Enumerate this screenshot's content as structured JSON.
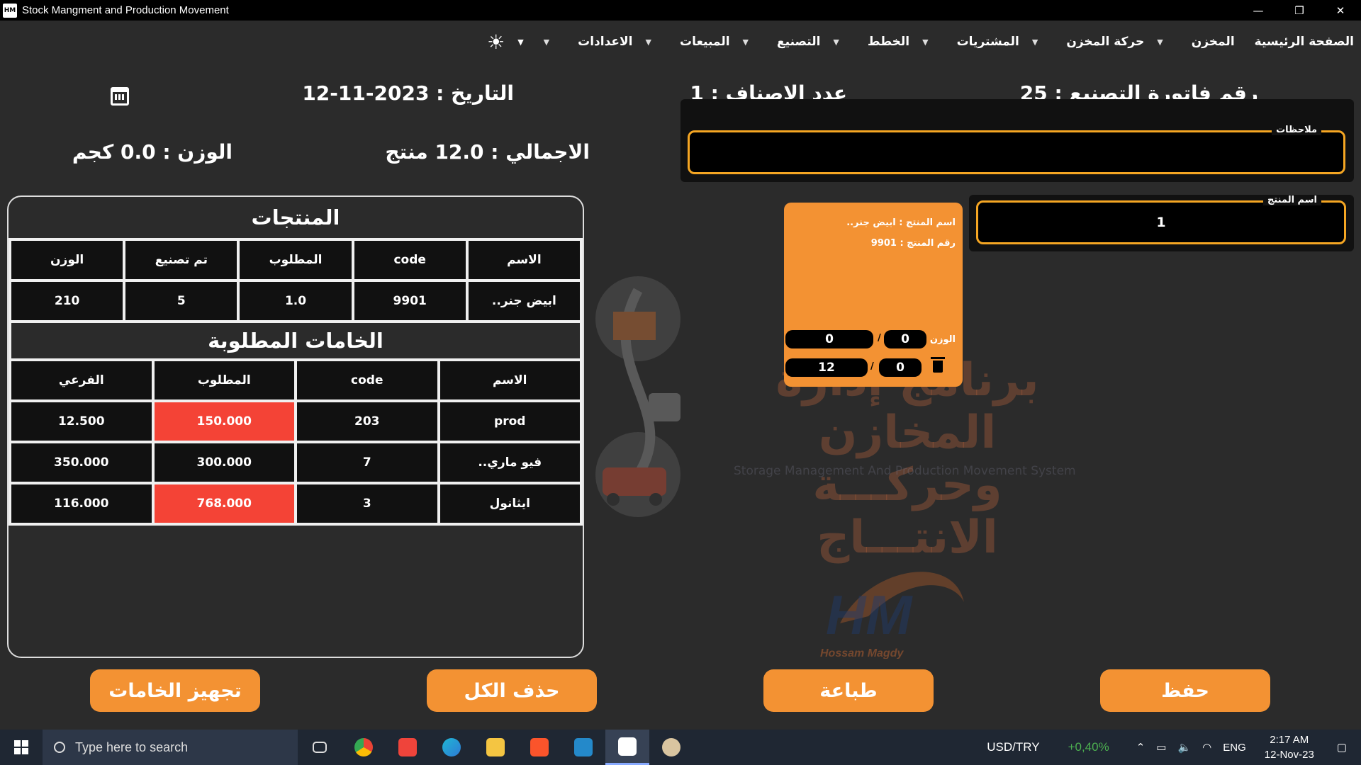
{
  "window": {
    "title": "Stock Mangment and Production Movement",
    "app_icon": "HM"
  },
  "menu": {
    "items": [
      {
        "label": "الصفحة الرئيسية",
        "has_caret": false
      },
      {
        "label": "المخزن",
        "has_caret": true
      },
      {
        "label": "حركة المخزن",
        "has_caret": true
      },
      {
        "label": "المشتريات",
        "has_caret": true
      },
      {
        "label": "الخطط",
        "has_caret": true
      },
      {
        "label": "التصنيع",
        "has_caret": true
      },
      {
        "label": "المبيعات",
        "has_caret": true
      },
      {
        "label": "الاعدادات",
        "has_caret": true
      }
    ],
    "theme_icon": "sun-icon"
  },
  "header": {
    "invoice": "رقم فاتورة التصنيع : 25",
    "items_count": "عدد الاصناف : 1",
    "date": "التاريخ : 2023-11-12",
    "total": "الاجمالي  :  12.0 منتج",
    "weight": "الوزن  :  0.0 كجم"
  },
  "notes": {
    "label": "ملاحظات",
    "value": ""
  },
  "product_field": {
    "label": "اسم المنتج",
    "value": "1"
  },
  "product_card": {
    "name_line": "اسم المنتج : ابيض جنر..",
    "code_line": "رقم المنتج : 9901",
    "weight_label": "الوزن",
    "weight_a": "0",
    "weight_b": "0",
    "qty_a": "0",
    "qty_b": "12",
    "slash": "/"
  },
  "products": {
    "title": "المنتجات",
    "columns": [
      "الاسم",
      "code",
      "المطلوب",
      "تم تصنيع",
      "الوزن"
    ],
    "rows": [
      [
        "ابيض جنر..",
        "9901",
        "1.0",
        "5",
        "210"
      ]
    ]
  },
  "materials": {
    "title": "الخامات المطلوبة",
    "columns": [
      "الاسم",
      "code",
      "المطلوب",
      "الفرعي"
    ],
    "rows": [
      {
        "cells": [
          "prod",
          "203",
          "150.000",
          "12.500"
        ],
        "shortage": true
      },
      {
        "cells": [
          "فيو ماري..",
          "7",
          "300.000",
          "350.000"
        ],
        "shortage": false
      },
      {
        "cells": [
          "ايثانول",
          "3",
          "768.000",
          "116.000"
        ],
        "shortage": true
      }
    ]
  },
  "watermark": {
    "arabic": "برنامج إدارة المخازن وحركـــة الانتـــاج",
    "english": "Storage Management And Production Movement System",
    "logo_text": "HM",
    "author": "Hossam Magdy"
  },
  "buttons": {
    "save": "حفظ",
    "print": "طباعة",
    "delete_all": "حذف الكل",
    "prepare_materials": "تجهيز الخامات"
  },
  "taskbar": {
    "search_placeholder": "Type here to search",
    "ticker": "USD/TRY",
    "ticker_change": "+0,40%",
    "lang": "ENG",
    "time": "2:17 AM",
    "date": "12-Nov-23"
  },
  "colors": {
    "accent": "#f39233",
    "shortage": "#f44336",
    "bg": "#2b2b2b"
  }
}
